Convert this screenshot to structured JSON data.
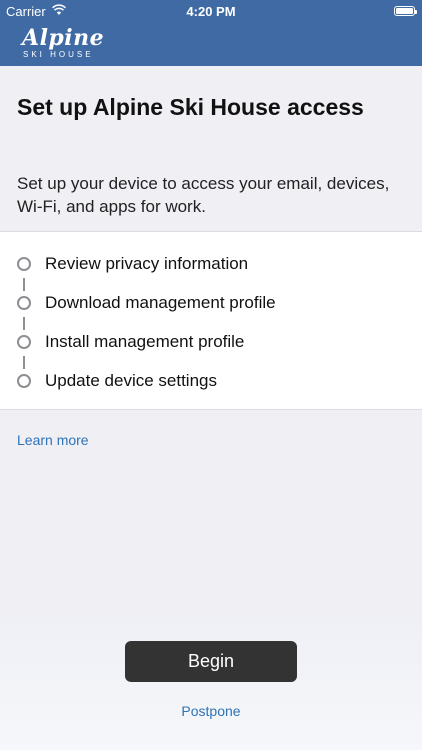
{
  "status_bar": {
    "carrier": "Carrier",
    "time": "4:20 PM"
  },
  "logo": {
    "main": "Alpine",
    "sub": "SKI HOUSE"
  },
  "title": "Set up Alpine Ski House access",
  "subtitle": "Set up your device to access your email, devices, Wi-Fi, and apps for work.",
  "steps": [
    {
      "label": "Review privacy information"
    },
    {
      "label": "Download management profile"
    },
    {
      "label": "Install management profile"
    },
    {
      "label": "Update device settings"
    }
  ],
  "learn_more": "Learn more",
  "begin_label": "Begin",
  "postpone_label": "Postpone",
  "colors": {
    "header": "#3f6aa4",
    "link": "#2d73b6",
    "button": "#333333"
  }
}
